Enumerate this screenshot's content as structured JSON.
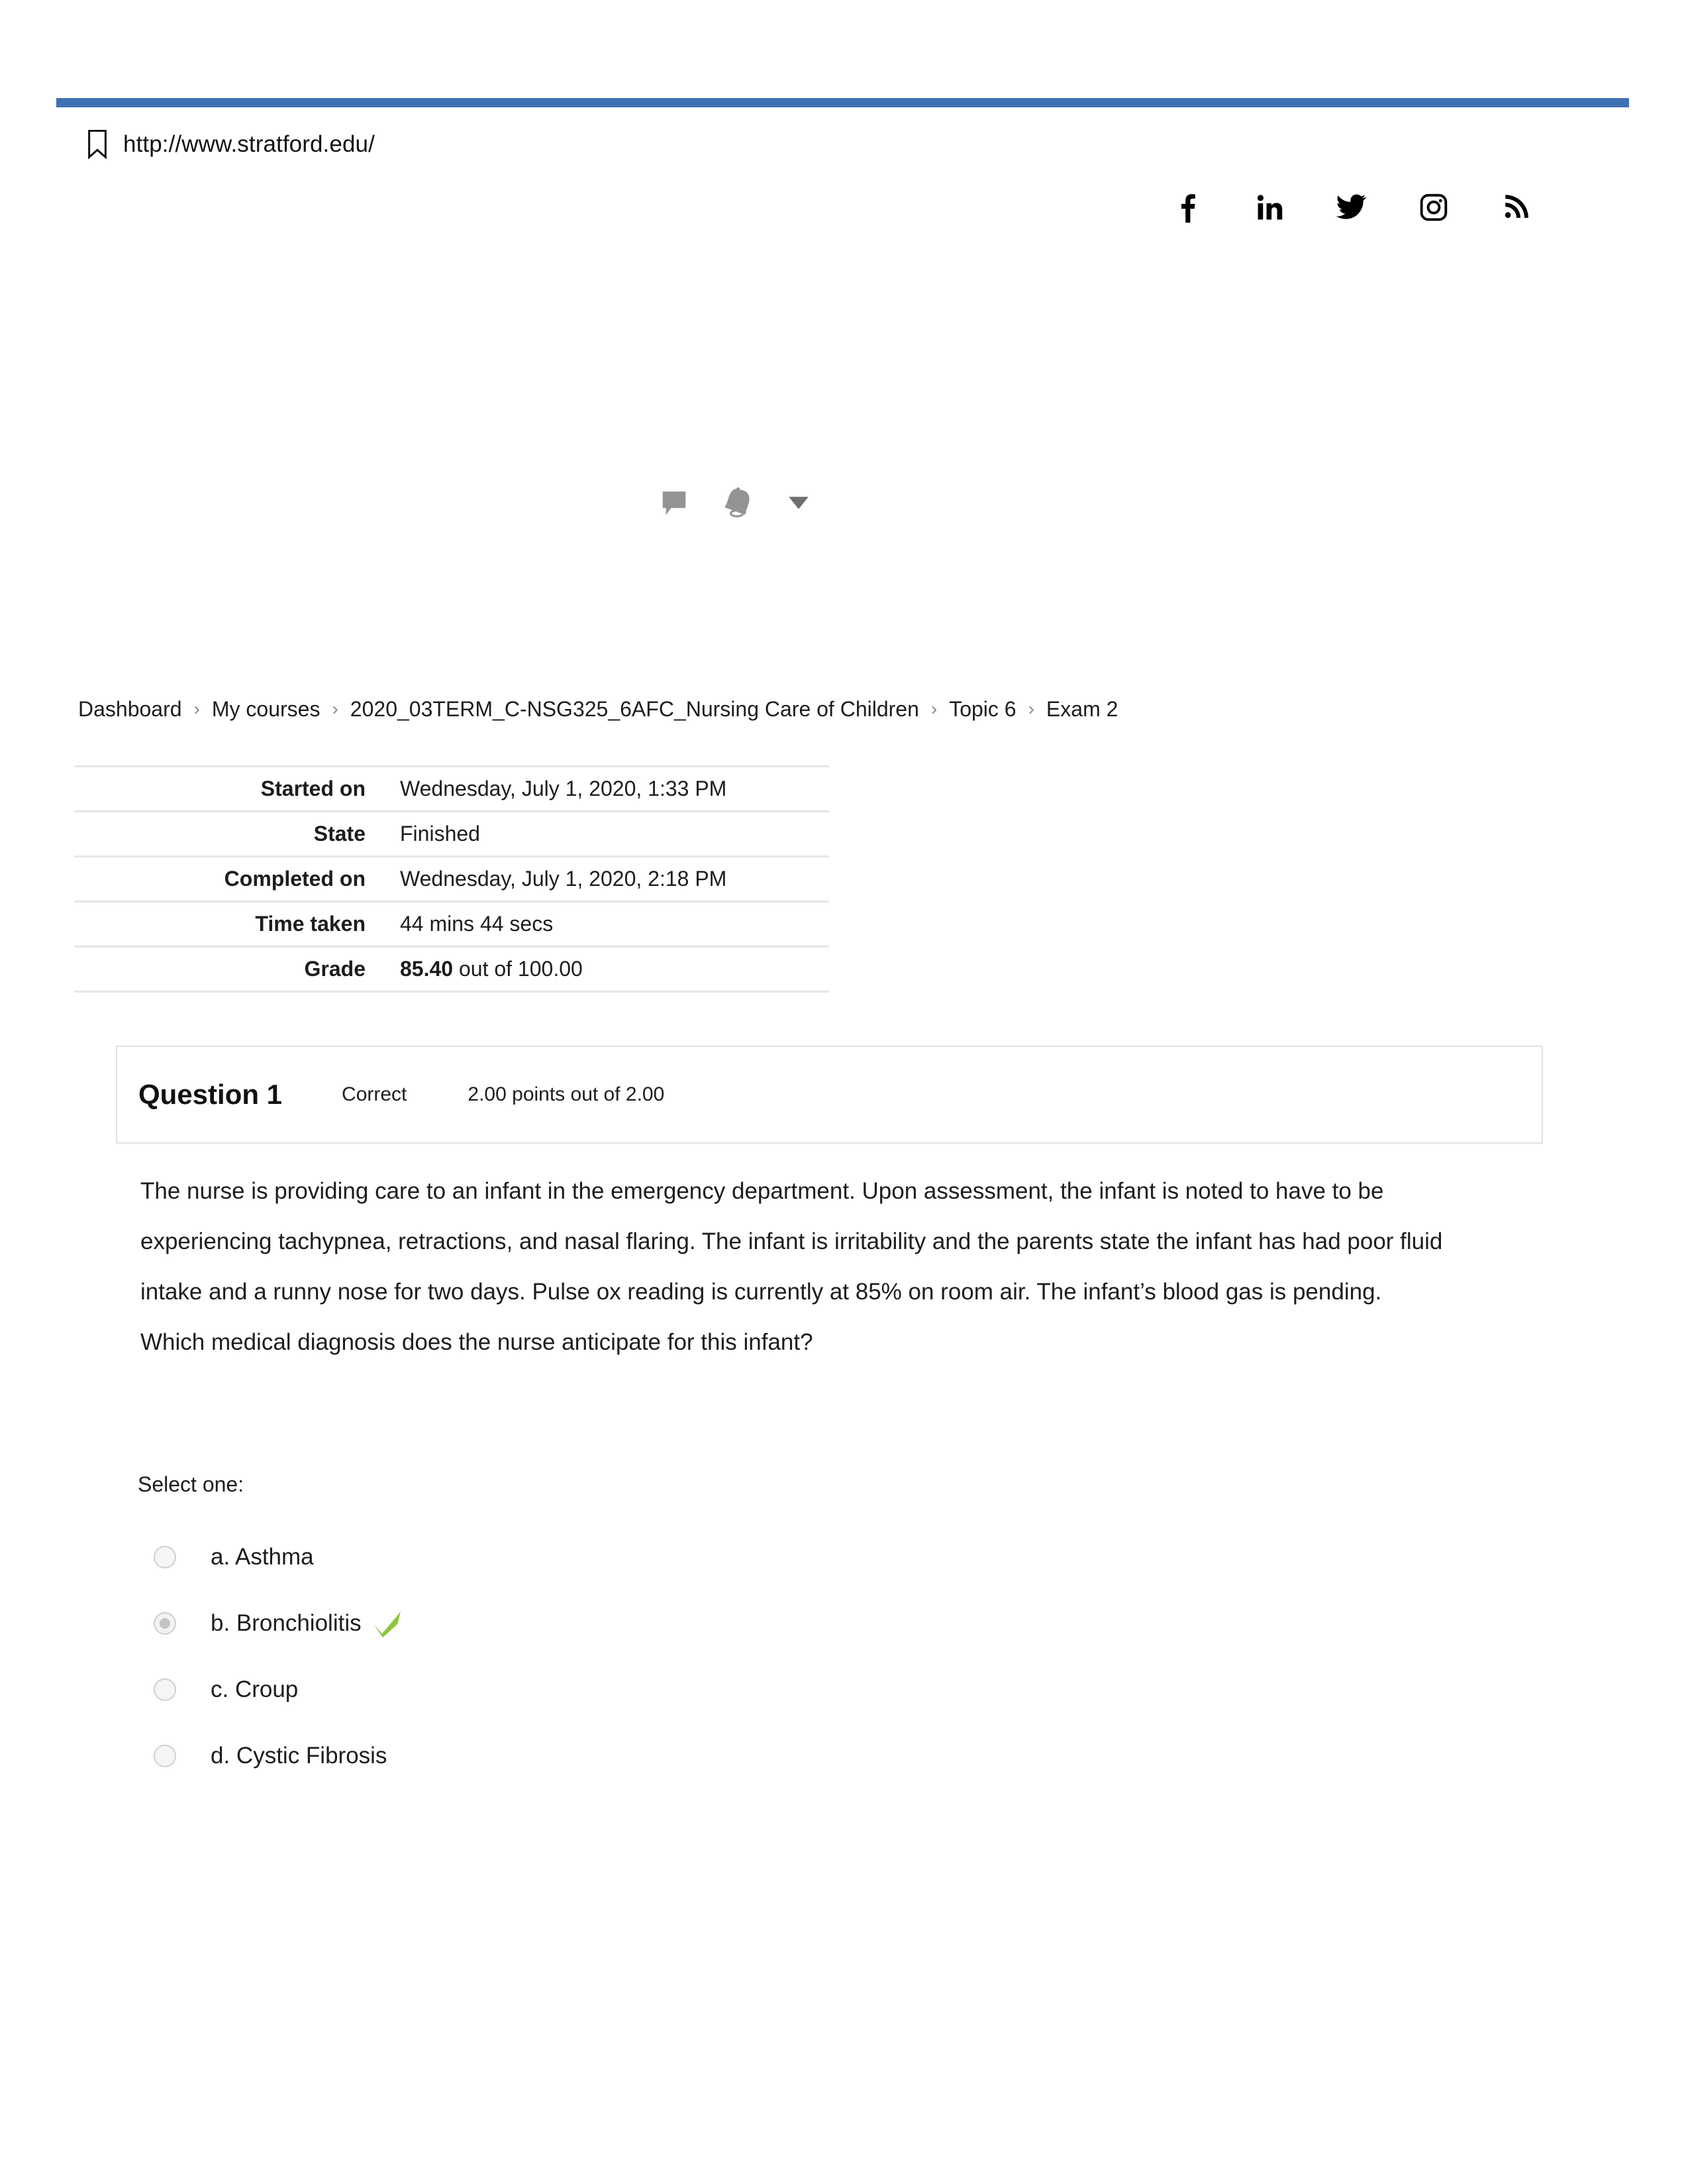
{
  "header": {
    "bar_color": "#3f72b5",
    "bookmark_icon": "bookmark-icon",
    "url": "http://www.stratford.edu/"
  },
  "social": {
    "items": [
      {
        "icon": "facebook-icon",
        "label": "Facebook"
      },
      {
        "icon": "linkedin-icon",
        "label": "LinkedIn"
      },
      {
        "icon": "twitter-icon",
        "label": "Twitter"
      },
      {
        "icon": "instagram-icon",
        "label": "Instagram"
      },
      {
        "icon": "rss-icon",
        "label": "RSS"
      }
    ]
  },
  "utilities": {
    "items": [
      {
        "icon": "message-bubble-icon",
        "label": "Messages"
      },
      {
        "icon": "bell-icon",
        "label": "Notifications"
      },
      {
        "icon": "chevron-down-icon",
        "label": "User menu"
      }
    ],
    "color": "#939393"
  },
  "breadcrumb": {
    "items": [
      "Dashboard",
      "My courses",
      "2020_03TERM_C-NSG325_6AFC_Nursing Care of Children",
      "Topic 6",
      "Exam 2"
    ],
    "separator": "›"
  },
  "summary": {
    "rows": [
      {
        "key": "Started on",
        "value": "Wednesday, July 1, 2020, 1:33 PM"
      },
      {
        "key": "State",
        "value": "Finished"
      },
      {
        "key": "Completed on",
        "value": "Wednesday, July 1, 2020, 2:18 PM"
      },
      {
        "key": "Time taken",
        "value": "44 mins 44 secs"
      }
    ],
    "grade": {
      "key": "Grade",
      "score": "85.40",
      "suffix": " out of 100.00"
    }
  },
  "question": {
    "title": "Question 1",
    "state": "Correct",
    "points": "2.00 points out of 2.00",
    "text": "The nurse is providing care to an infant in the emergency department. Upon assessment, the infant is noted to have to be experiencing tachypnea, retractions, and nasal flaring. The infant is irritability and the parents state the infant has had poor fluid intake and a runny nose for two days. Pulse ox reading is currently at 85% on room air. The infant’s blood gas is pending. Which medical diagnosis does the nurse anticipate for this infant?",
    "select_prompt": "Select one:",
    "correct_mark_color": "#8cc63f",
    "options": [
      {
        "label": "a. Asthma",
        "selected": false,
        "correct_mark": false
      },
      {
        "label": "b. Bronchiolitis",
        "selected": true,
        "correct_mark": true
      },
      {
        "label": "c. Croup",
        "selected": false,
        "correct_mark": false
      },
      {
        "label": "d. Cystic Fibrosis",
        "selected": false,
        "correct_mark": false
      }
    ]
  }
}
